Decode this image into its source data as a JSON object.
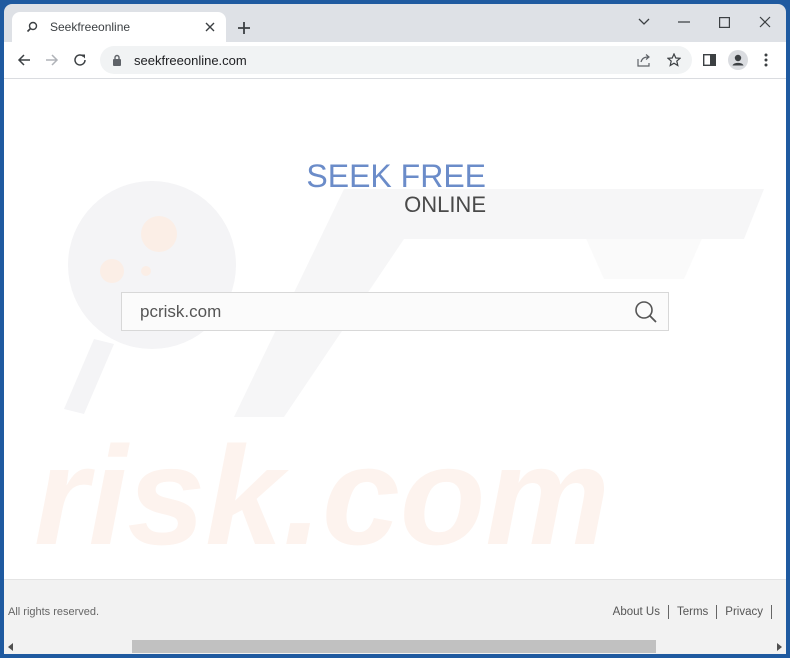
{
  "browser": {
    "tab": {
      "title": "Seekfreeonline",
      "icon": "search-icon"
    },
    "new_tab_icon": "plus-icon",
    "window_controls": [
      "chevron-down-icon",
      "minimize-icon",
      "maximize-icon",
      "close-icon"
    ],
    "toolbar": {
      "back_icon": "arrow-left-icon",
      "forward_icon": "arrow-right-icon",
      "reload_icon": "reload-icon",
      "url": "seekfreeonline.com",
      "lock_icon": "lock-icon",
      "share_icon": "share-icon",
      "bookmark_icon": "star-icon",
      "side_panel_icon": "side-panel-icon",
      "profile_icon": "profile-icon",
      "menu_icon": "kebab-menu-icon"
    }
  },
  "page": {
    "logo": {
      "line1": "SEEK FREE",
      "line2": "ONLINE",
      "colors": {
        "line1": "#6b8cc9",
        "line2": "#4a4a4a"
      }
    },
    "search": {
      "value": "pcrisk.com",
      "button_icon": "search-icon"
    },
    "watermark": "pcrisk.com"
  },
  "footer": {
    "copyright": "All rights reserved.",
    "links": [
      "About Us",
      "Terms",
      "Privacy"
    ]
  }
}
